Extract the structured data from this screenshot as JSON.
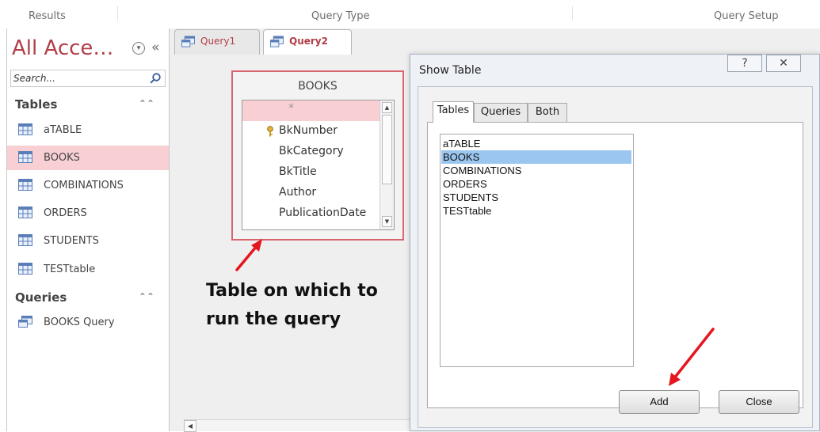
{
  "ribbon": {
    "groups": [
      "Results",
      "Query Type",
      "Query Setup"
    ]
  },
  "nav": {
    "title": "All Acce…",
    "search_placeholder": "Search...",
    "groups": [
      {
        "label": "Tables",
        "items": [
          "aTABLE",
          "BOOKS",
          "COMBINATIONS",
          "ORDERS",
          "STUDENTS",
          "TESTtable"
        ]
      },
      {
        "label": "Queries",
        "items": [
          "BOOKS Query"
        ]
      }
    ],
    "selected_item": "BOOKS"
  },
  "doc_tabs": [
    "Query1",
    "Query2"
  ],
  "active_doc_tab": "Query2",
  "table_box": {
    "title": "BOOKS",
    "fields": [
      "*",
      "BkNumber",
      "BkCategory",
      "BkTitle",
      "Author",
      "PublicationDate"
    ],
    "primary_key": "BkNumber"
  },
  "annotation": "Table on which to run the query",
  "dialog": {
    "title": "Show Table",
    "help_glyph": "?",
    "close_glyph": "✕",
    "tabs": [
      "Tables",
      "Queries",
      "Both"
    ],
    "active_tab": "Tables",
    "tables": [
      "aTABLE",
      "BOOKS",
      "COMBINATIONS",
      "ORDERS",
      "STUDENTS",
      "TESTtable"
    ],
    "selected_table": "BOOKS",
    "add_label": "Add",
    "close_label": "Close"
  },
  "colors": {
    "accent": "#b13e48",
    "selection_pink": "#f8cfd3",
    "list_selection": "#9bc6f0",
    "annotation_arrow": "#e4161e"
  }
}
